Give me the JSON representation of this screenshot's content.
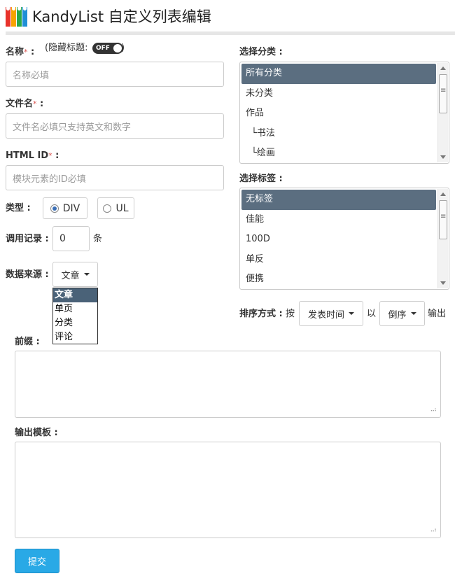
{
  "header": {
    "title": "KandyList 自定义列表编辑",
    "logo_colors": [
      "#e8322b",
      "#f7a300",
      "#2aa84a",
      "#1f8fd6"
    ]
  },
  "form": {
    "name": {
      "label": "名称",
      "required_mark": "*",
      "colon": ":",
      "placeholder": "名称必填",
      "value": ""
    },
    "hide_title": {
      "label": "(隐藏标题:",
      "close": ")",
      "state": "OFF"
    },
    "filename": {
      "label": "文件名",
      "required_mark": "*",
      "colon": ":",
      "placeholder": "文件名必填只支持英文和数字",
      "value": ""
    },
    "html_id": {
      "label": "HTML ID",
      "required_mark": "*",
      "colon": ":",
      "placeholder": "模块元素的ID必填",
      "value": ""
    },
    "type": {
      "label": "类型 :",
      "options": [
        "DIV",
        "UL"
      ],
      "selected": "DIV"
    },
    "count": {
      "label": "调用记录 :",
      "value": "0",
      "unit": "条"
    },
    "source": {
      "label": "数据来源 :",
      "selected": "文章",
      "options": [
        "文章",
        "单页",
        "分类",
        "评论"
      ]
    },
    "category": {
      "label": "选择分类 :",
      "items": [
        "所有分类",
        "未分类",
        "作品",
        "└书法",
        "└绘画"
      ],
      "selected": "所有分类"
    },
    "tags": {
      "label": "选择标签 :",
      "items": [
        "无标签",
        "佳能",
        "100D",
        "单反",
        "便携"
      ],
      "selected": "无标签"
    },
    "sort": {
      "label": "排序方式 :",
      "by_text": "按",
      "field": "发表时间",
      "with_text": "以",
      "order": "倒序",
      "output_text": "输出"
    },
    "prefix": {
      "label": "前缀 :",
      "value": ""
    },
    "template": {
      "label": "输出模板 :",
      "value": ""
    },
    "submit_label": "提交"
  },
  "colors": {
    "selected_item": "#5b6e80",
    "submit_bg": "#29a9e6",
    "required": "#d9534f"
  }
}
